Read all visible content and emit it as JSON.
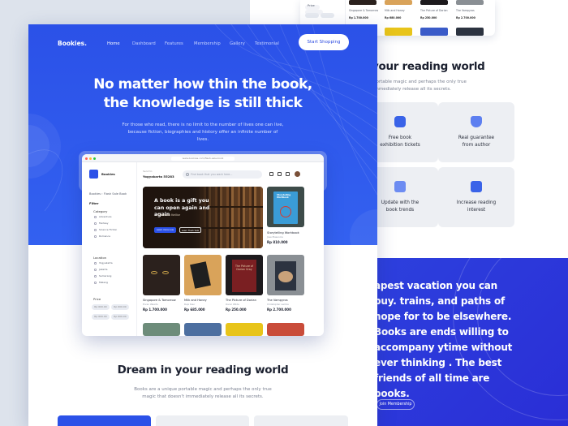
{
  "back_page": {
    "mini_filter_label": "Price",
    "mini_books": [
      {
        "title": "Singapore & Tomorrow",
        "price": "Rp 1.700.000"
      },
      {
        "title": "Milk and Honey",
        "price": "Rp 680.000"
      },
      {
        "title": "The Picture of Dorian",
        "price": "Rp 250.000"
      },
      {
        "title": "The Vampyros",
        "price": "Rp 2.700.000"
      }
    ],
    "heading": "your reading world",
    "paragraph": "portable magic and perhaps the only true\n immediately release all its secrets.",
    "features": [
      {
        "label": "Free book\nexhibition tickets",
        "icon": "ticket-icon"
      },
      {
        "label": "Real guarantee\nfrom author",
        "icon": "shield-check-icon"
      },
      {
        "label": "Update with the\nbook trends",
        "icon": "chart-icon"
      },
      {
        "label": "Increase reading\ninterest",
        "icon": "trend-up-icon"
      }
    ],
    "quote": "apest vacation you can buy. trains, and paths of hope for to be elsewhere. Books are ends willing to accompany ytime without ever thinking . The best friends of all time are books.",
    "join_button": "Join Membership"
  },
  "nav": {
    "brand": "Bookies.",
    "links": [
      "Home",
      "Dashboard",
      "Features",
      "Membership",
      "Gallery",
      "Testimonial"
    ],
    "active": "Home",
    "cta": "Start Shopping"
  },
  "hero": {
    "title_line1": "No matter how thin the book,",
    "title_line2": "the knowledge is still thick",
    "subtitle": "For those who read, there is no limit to the number of lives one can live, because fiction, biographies and history offer an infinite number of lives."
  },
  "mockup": {
    "url": "www.bookies.com/flash-sale-book",
    "brand": "Bookies",
    "breadcrumb": "Bookies › Flash Sale Book",
    "send_to_label": "Send to",
    "send_to_value": "Yogyakarta 55283",
    "search_placeholder": "Find book that you want here...",
    "filter_title": "Filter",
    "category_title": "Category",
    "categories": [
      "Adventure",
      "Fantasy",
      "Science Fiction",
      "Romance"
    ],
    "location_title": "Location",
    "locations": [
      "Yogyakarta",
      "Jakarta",
      "Semarang",
      "Malang"
    ],
    "price_title": "Price",
    "price_pills": [
      "Rp 600.00",
      "Rp 600.00",
      "Rp 600.00",
      "Rp 600.00"
    ],
    "banner": {
      "headline": "A book is a gift you can open again and again",
      "author": "— Garrison Keillor",
      "primary_button": "Learn more now",
      "secondary_button": "Learn Flash Sale"
    },
    "featured": {
      "title": "Storytelling Workbook",
      "author": "Jose Plasencia",
      "price": "Rp 810.000",
      "cover": "Storytelling Workbook"
    },
    "books": [
      {
        "title": "Singapore & Tomorrow",
        "author": "Ervan Waarts",
        "price": "Rp 1.700.000",
        "cover_bg": "#2b211d"
      },
      {
        "title": "Milk and Honey",
        "author": "Rupi Kaur",
        "price": "Rp 685.000",
        "cover_bg": "#d9a35a"
      },
      {
        "title": "The Picture of Dorian",
        "author": "Oscar Wilde",
        "price": "Rp 250.000",
        "cover_bg": "#1d1a1d",
        "cover": "The Picture of Dorian Gray"
      },
      {
        "title": "The Vampyros",
        "author": "Christopher Lamba",
        "price": "Rp 2.700.000",
        "cover_bg": "#8a8f94"
      }
    ]
  },
  "section": {
    "heading": "Dream in your reading world",
    "paragraph": "Books are a unique portable magic and perhaps the only true magic that doesn't immediately release all its secrets."
  },
  "colors": {
    "primary": "#2b51e8",
    "dark": "#1c2130",
    "muted": "#7c8292"
  }
}
